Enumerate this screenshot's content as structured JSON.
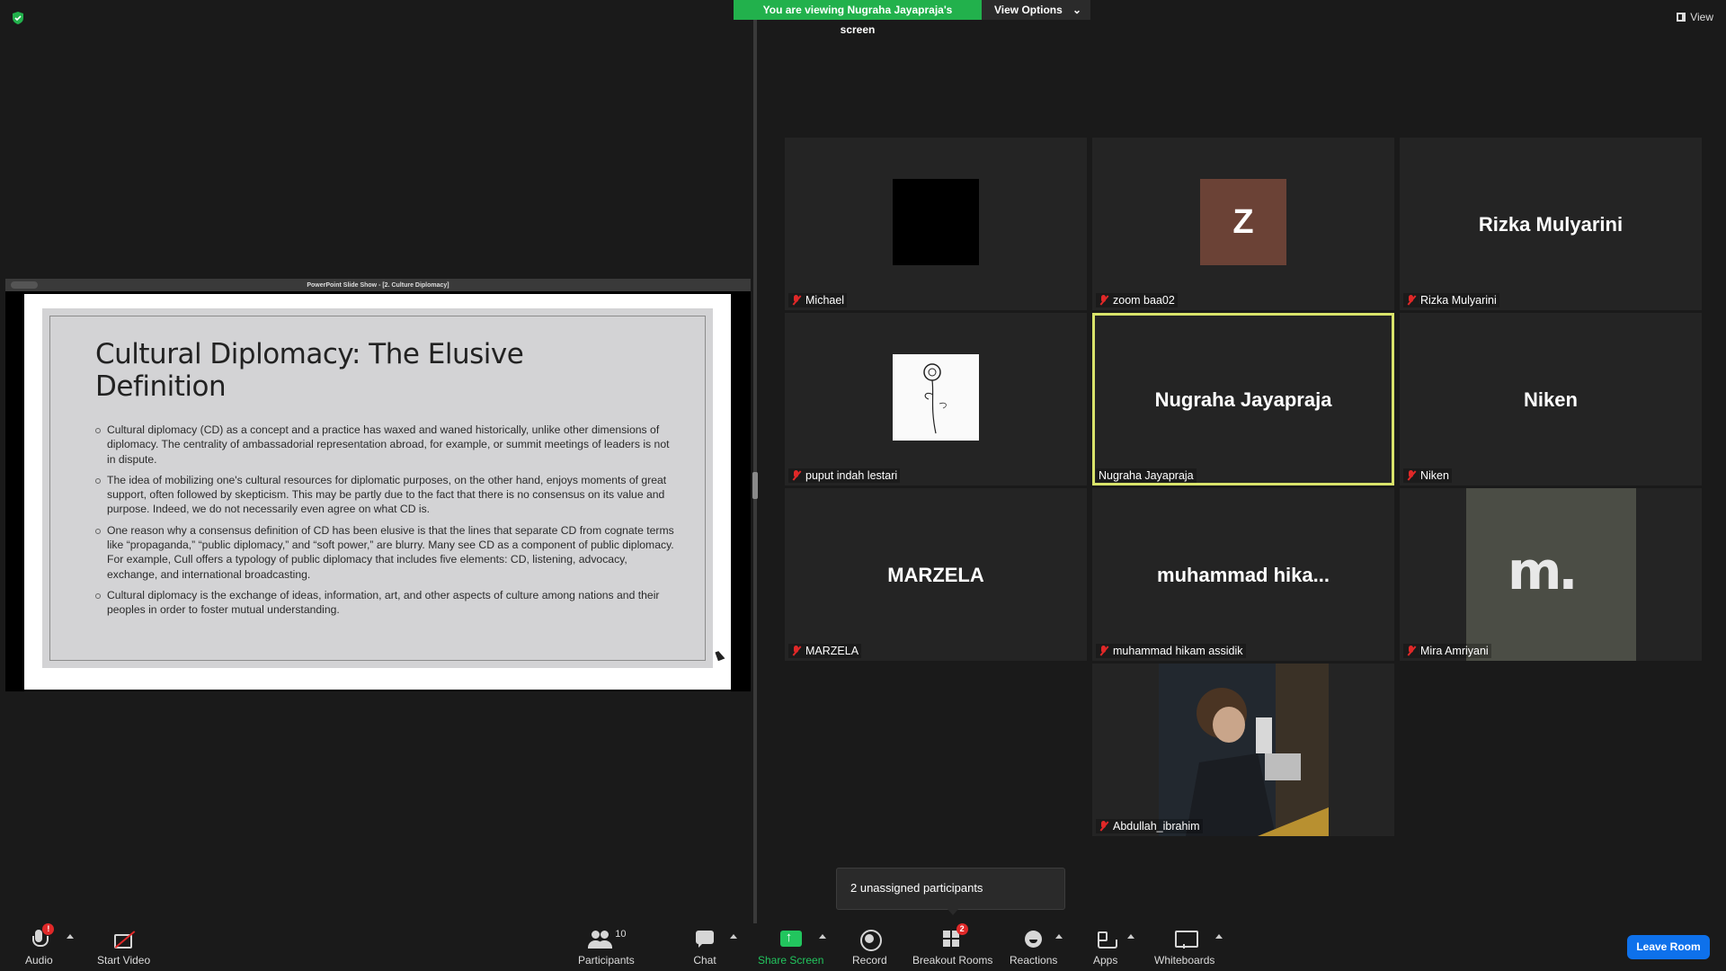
{
  "header": {
    "viewing_text": "You are viewing Nugraha Jayapraja's screen",
    "view_options_label": "View Options",
    "view_label": "View"
  },
  "shared_screen": {
    "window_title": "PowerPoint Slide Show - [2. Culture Diplomacy]",
    "slide_title": "Cultural Diplomacy: The Elusive Definition",
    "bullets": [
      "Cultural diplomacy (CD) as a concept and a practice has waxed and waned historically, unlike other dimensions of diplomacy. The centrality of ambassadorial representation abroad, for example, or summit meetings of leaders is not in dispute.",
      "The idea of mobilizing one's cultural resources for diplomatic purposes, on the other hand, enjoys moments of great support, often followed by skepticism. This may be partly due to the fact that there is no consensus on its value and purpose. Indeed, we do not necessarily even agree on what CD is.",
      "One reason why a consensus definition of CD has been elusive is that the lines that separate CD from cognate terms like “propaganda,” “public diplomacy,” and “soft power,” are blurry. Many see CD as a component of public diplomacy. For example, Cull offers a typology of public diplomacy that includes five elements: CD, listening, advocacy, exchange, and international broadcasting.",
      "Cultural diplomacy is the exchange of ideas, information, art, and other aspects of culture among nations and their peoples in order to foster mutual understanding."
    ]
  },
  "participants": [
    {
      "label": "Michael",
      "big_name": "",
      "muted": true
    },
    {
      "label": "zoom baa02",
      "big_name": "",
      "avatar_letter": "Z",
      "muted": true
    },
    {
      "label": "Rizka Mulyarini",
      "big_name": "Rizka Mulyarini",
      "muted": true
    },
    {
      "label": "puput indah lestari",
      "big_name": "",
      "muted": true
    },
    {
      "label": "Nugraha Jayapraja",
      "big_name": "Nugraha Jayapraja",
      "muted": false,
      "active": true
    },
    {
      "label": "Niken",
      "big_name": "Niken",
      "muted": true
    },
    {
      "label": "MARZELA",
      "big_name": "MARZELA",
      "muted": true
    },
    {
      "label": "muhammad hikam assidik",
      "big_name": "muhammad  hika...",
      "muted": true
    },
    {
      "label": "Mira Amriyani",
      "big_name": "",
      "logo_text": "m.",
      "muted": true
    },
    {
      "label": "Abdullah_ibrahim",
      "big_name": "",
      "muted": true
    }
  ],
  "breakout_popup": {
    "text": "2 unassigned participants"
  },
  "toolbar": {
    "audio_label": "Audio",
    "audio_badge": "!",
    "video_label": "Start Video",
    "participants_label": "Participants",
    "participants_count": "10",
    "chat_label": "Chat",
    "share_label": "Share Screen",
    "record_label": "Record",
    "breakout_label": "Breakout Rooms",
    "breakout_badge": "2",
    "reactions_label": "Reactions",
    "apps_label": "Apps",
    "whiteboards_label": "Whiteboards",
    "leave_label": "Leave Room"
  },
  "colors": {
    "share_green": "#22c55e",
    "banner_green": "#22b14c",
    "leave_blue": "#0e71eb",
    "active_outline": "#d9e36a",
    "mute_red": "#e02828"
  }
}
